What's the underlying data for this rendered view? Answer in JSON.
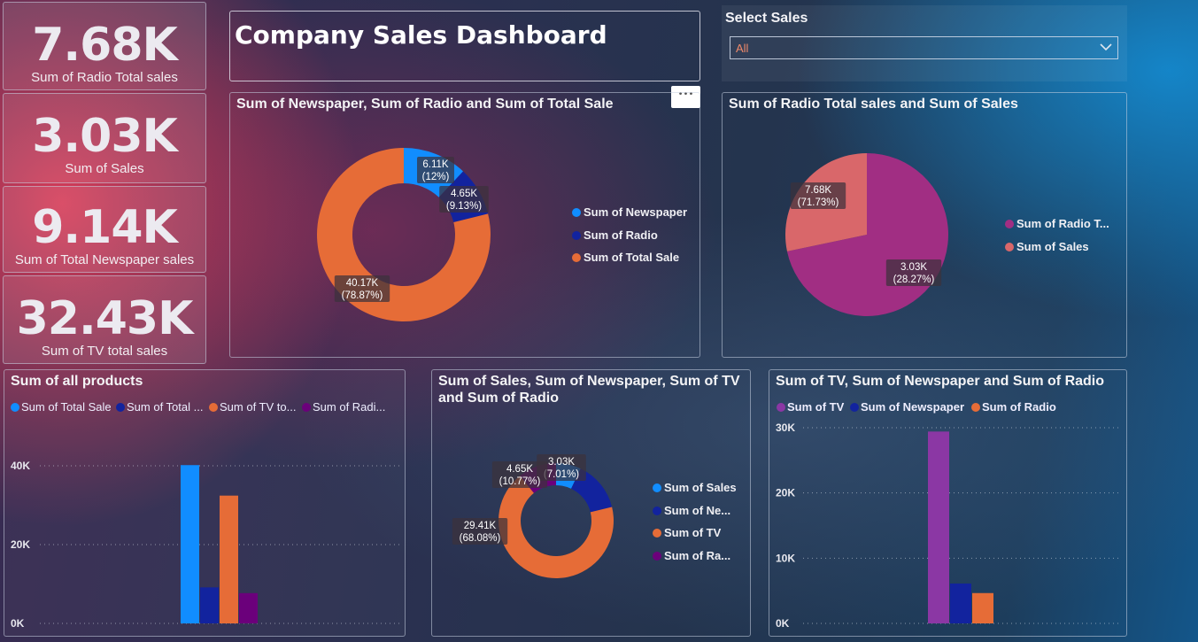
{
  "kpis": [
    {
      "value": "7.68K",
      "label": "Sum of Radio Total sales"
    },
    {
      "value": "3.03K",
      "label": "Sum of Sales"
    },
    {
      "value": "9.14K",
      "label": "Sum of Total Newspaper sales"
    },
    {
      "value": "32.43K",
      "label": "Sum of TV total sales"
    }
  ],
  "dashboard_title": "Company Sales Dashboard",
  "slicer": {
    "title": "Select Sales",
    "value": "All"
  },
  "more_options": "•••",
  "colors": {
    "blue": "#118DFF",
    "navy": "#12239E",
    "orange": "#E66C37",
    "purple": "#6B007B",
    "magenta": "#A12E83",
    "coral": "#D9676A",
    "violet": "#8B37A4"
  },
  "chart_data": [
    {
      "id": "donut1",
      "type": "pie",
      "title": "Sum of Newspaper, Sum of Radio and Sum of Total Sale",
      "slices": [
        {
          "name": "Sum of Newspaper",
          "value": 6.11,
          "label": "6.11K",
          "pct": "(12%)",
          "color": "#118DFF"
        },
        {
          "name": "Sum of Radio",
          "value": 4.65,
          "label": "4.65K",
          "pct": "(9.13%)",
          "color": "#12239E"
        },
        {
          "name": "Sum of Total Sale",
          "value": 40.17,
          "label": "40.17K",
          "pct": "(78.87%)",
          "color": "#E66C37"
        }
      ]
    },
    {
      "id": "pie2",
      "type": "pie",
      "title": "Sum of Radio Total sales and Sum of Sales",
      "slices": [
        {
          "name": "Sum of Radio T...",
          "value": 7.68,
          "label": "7.68K",
          "pct": "(71.73%)",
          "color": "#A12E83"
        },
        {
          "name": "Sum of Sales",
          "value": 3.03,
          "label": "3.03K",
          "pct": "(28.27%)",
          "color": "#D9676A"
        }
      ]
    },
    {
      "id": "bar1",
      "type": "bar",
      "title": "Sum of all products",
      "series": [
        {
          "name": "Sum of Total Sale",
          "value": 40170,
          "color": "#118DFF"
        },
        {
          "name": "Sum of Total ...",
          "value": 9140,
          "color": "#12239E"
        },
        {
          "name": "Sum of TV to...",
          "value": 32430,
          "color": "#E66C37"
        },
        {
          "name": "Sum of Radi...",
          "value": 7680,
          "color": "#6B007B"
        }
      ],
      "ylim": [
        0,
        40000
      ],
      "yticks": [
        "0K",
        "20K",
        "40K"
      ]
    },
    {
      "id": "donut2",
      "type": "pie",
      "title": "Sum of Sales, Sum of Newspaper, Sum of TV and Sum of Radio",
      "slices": [
        {
          "name": "Sum of Sales",
          "value": 3.03,
          "label": "3.03K",
          "pct": "(7.01%)",
          "color": "#118DFF"
        },
        {
          "name": "Sum of Ne...",
          "value": 6.11,
          "label": "",
          "pct": "",
          "color": "#12239E"
        },
        {
          "name": "Sum of TV",
          "value": 29.41,
          "label": "29.41K",
          "pct": "(68.08%)",
          "color": "#E66C37"
        },
        {
          "name": "Sum of Ra...",
          "value": 4.65,
          "label": "4.65K",
          "pct": "(10.77%)",
          "color": "#6B007B"
        }
      ]
    },
    {
      "id": "bar2",
      "type": "bar",
      "title": "Sum of TV, Sum of Newspaper and Sum of Radio",
      "series": [
        {
          "name": "Sum of TV",
          "value": 29410,
          "color": "#8B37A4"
        },
        {
          "name": "Sum of Newspaper",
          "value": 6110,
          "color": "#12239E"
        },
        {
          "name": "Sum of Radio",
          "value": 4650,
          "color": "#E66C37"
        }
      ],
      "ylim": [
        0,
        30000
      ],
      "yticks": [
        "0K",
        "10K",
        "20K",
        "30K"
      ]
    }
  ]
}
